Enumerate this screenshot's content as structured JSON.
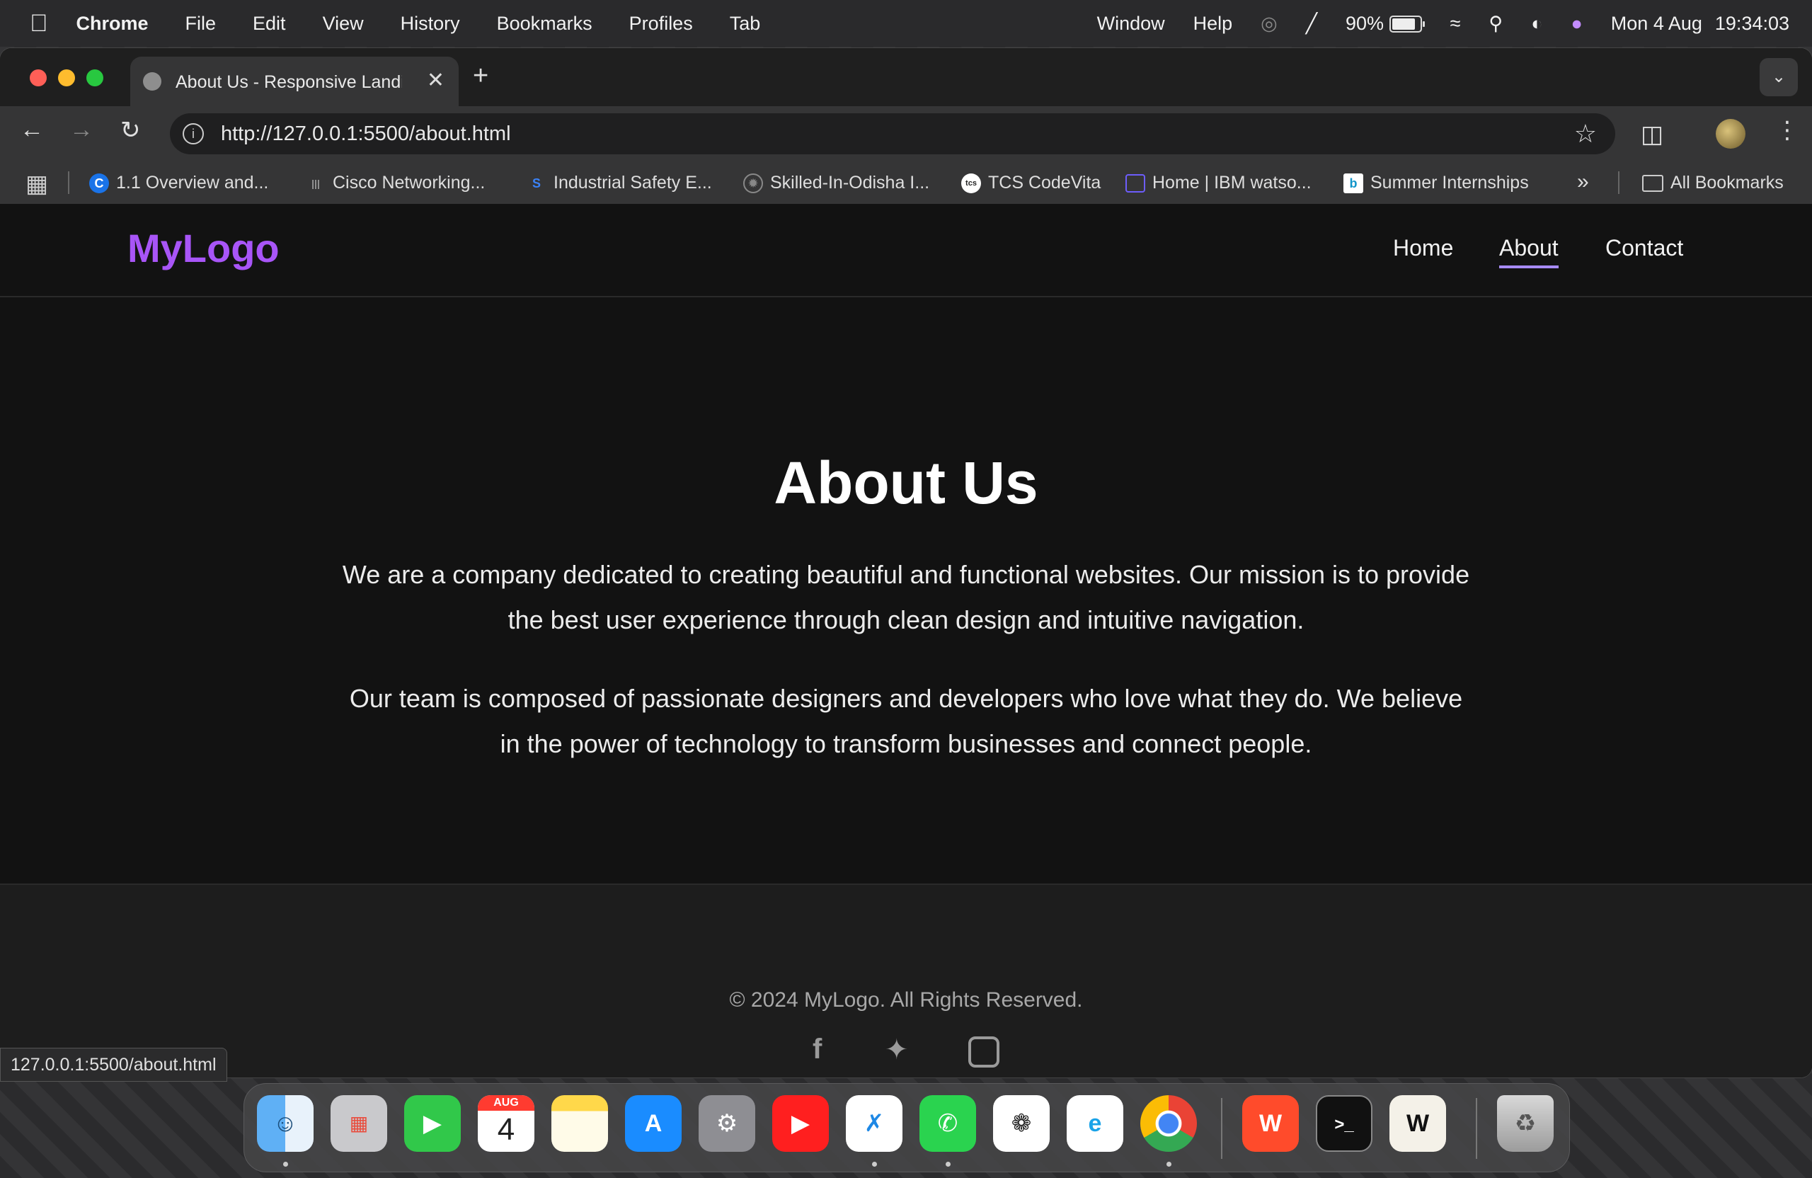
{
  "menubar": {
    "app_name": "Chrome",
    "items": [
      "File",
      "Edit",
      "View",
      "History",
      "Bookmarks",
      "Profiles",
      "Tab",
      "Window",
      "Help"
    ],
    "battery": "90%",
    "date": "Mon 4 Aug",
    "time": "19:34:03"
  },
  "browser": {
    "tab_title": "About Us - Responsive Landing",
    "url": "http://127.0.0.1:5500/about.html",
    "bookmarks": [
      {
        "label": "1.1 Overview and...",
        "icon": "C",
        "color": "#1a73e8"
      },
      {
        "label": "Cisco Networking...",
        "icon": "cisco-icon",
        "color": "#999999"
      },
      {
        "label": "Industrial Safety E...",
        "icon": "S",
        "color": "#3b82f6"
      },
      {
        "label": "Skilled-In-Odisha I...",
        "icon": "gear-icon",
        "color": "#888888"
      },
      {
        "label": "TCS CodeVita",
        "icon": "tcs",
        "color": "#ffffff"
      },
      {
        "label": "Home | IBM watso...",
        "icon": "chat-icon",
        "color": "#6d5dfc"
      },
      {
        "label": "Summer Internships",
        "icon": "internshala-icon",
        "color": "#ffffff"
      }
    ],
    "all_bookmarks": "All Bookmarks",
    "status_url": "127.0.0.1:5500/about.html"
  },
  "site": {
    "logo": "MyLogo",
    "nav": [
      "Home",
      "About",
      "Contact"
    ],
    "active_nav": "About",
    "heading": "About Us",
    "paragraph1": "We are a company dedicated to creating beautiful and functional websites. Our mission is to provide the best user experience through clean design and intuitive navigation.",
    "paragraph2": "Our team is composed of passionate designers and developers who love what they do. We believe in the power of technology to transform businesses and connect people.",
    "footer_text": "© 2024 MyLogo. All Rights Reserved.",
    "social_icons": [
      "facebook-icon",
      "twitter-icon",
      "instagram-icon"
    ]
  },
  "dock": {
    "apps": [
      "finder",
      "launchpad",
      "facetime",
      "calendar",
      "notes",
      "app-store",
      "system-settings",
      "youtube-music",
      "vscode",
      "whatsapp",
      "chatgpt",
      "edge",
      "chrome",
      "wps-office",
      "terminal",
      "notion",
      "trash"
    ],
    "calendar_month": "AUG",
    "calendar_day": "4"
  },
  "colors": {
    "accent": "#a855f7",
    "nav_underline": "#a78bfa",
    "page_bg": "#121212",
    "footer_bg": "#1d1d1d"
  }
}
